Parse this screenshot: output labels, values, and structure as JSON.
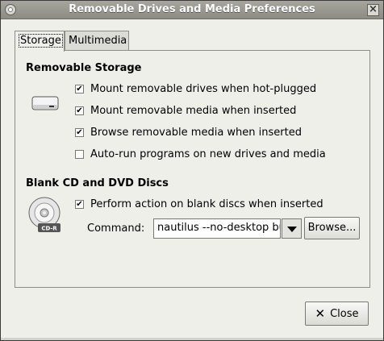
{
  "window": {
    "title": "Removable Drives and Media Preferences"
  },
  "tabs": [
    {
      "label": "Storage",
      "active": true
    },
    {
      "label": "Multimedia",
      "active": false
    }
  ],
  "removable_storage": {
    "heading": "Removable Storage",
    "options": [
      {
        "label": "Mount removable drives when hot-plugged",
        "checked": true
      },
      {
        "label": "Mount removable media when inserted",
        "checked": true
      },
      {
        "label": "Browse removable media when inserted",
        "checked": true
      },
      {
        "label": "Auto-run programs on new drives and media",
        "checked": false
      }
    ]
  },
  "blank_discs": {
    "heading": "Blank CD and DVD Discs",
    "perform_action": {
      "label": "Perform action on blank discs when inserted",
      "checked": true
    },
    "command_label": "Command:",
    "command_value": "nautilus --no-desktop bu",
    "browse_label": "Browse...",
    "cd_badge": "CD-R"
  },
  "footer": {
    "close_label": "Close",
    "close_icon": "x-icon"
  },
  "icons": {
    "drive": "drive-icon",
    "cd": "cd-icon",
    "window_menu": "window-menu-icon",
    "window_close": "window-close-icon"
  }
}
